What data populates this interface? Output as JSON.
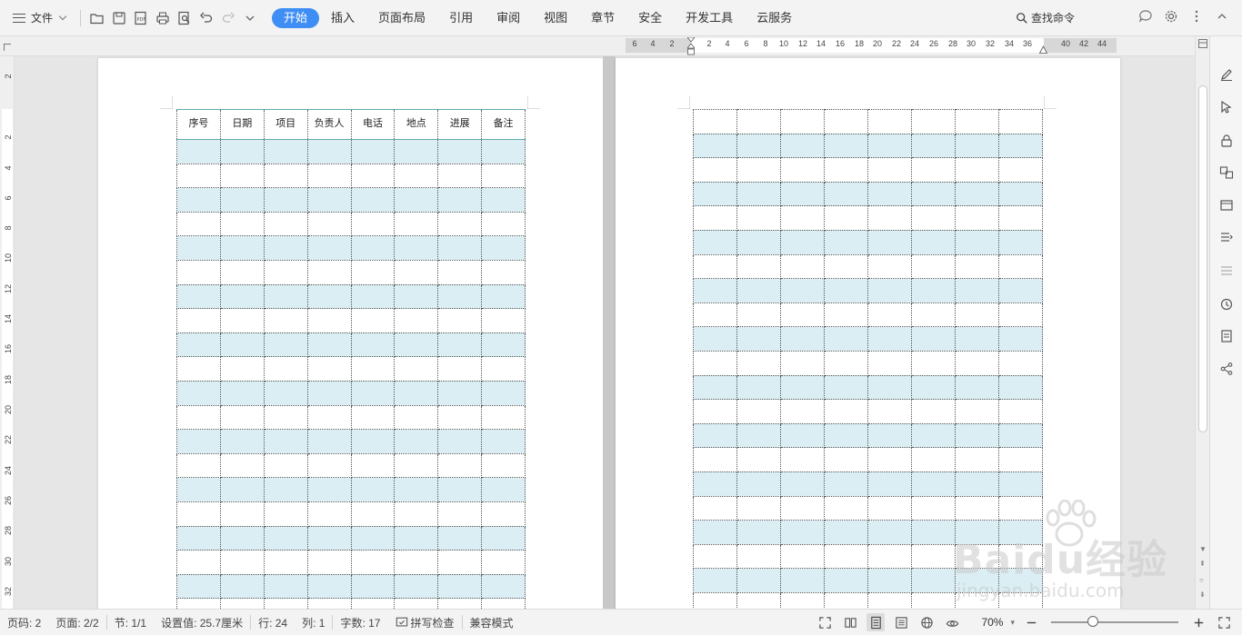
{
  "toolbar": {
    "file_label": "文件",
    "tabs": [
      {
        "label": "开始",
        "active": true
      },
      {
        "label": "插入",
        "active": false
      },
      {
        "label": "页面布局",
        "active": false
      },
      {
        "label": "引用",
        "active": false
      },
      {
        "label": "审阅",
        "active": false
      },
      {
        "label": "视图",
        "active": false
      },
      {
        "label": "章节",
        "active": false
      },
      {
        "label": "安全",
        "active": false
      },
      {
        "label": "开发工具",
        "active": false
      },
      {
        "label": "云服务",
        "active": false
      }
    ],
    "search_label": "查找命令",
    "quick_access_icons": [
      "open-folder-icon",
      "save-icon",
      "pdf-icon",
      "print-icon",
      "print-preview-icon",
      "undo-icon",
      "redo-icon",
      "dropdown-icon"
    ],
    "accent_color": "#3f8ef5"
  },
  "ruler": {
    "horizontal_ticks": [
      "6",
      "4",
      "2",
      "2",
      "4",
      "6",
      "8",
      "10",
      "12",
      "14",
      "16",
      "18",
      "20",
      "22",
      "24",
      "26",
      "28",
      "30",
      "32",
      "34",
      "36",
      "40",
      "42",
      "44"
    ],
    "vertical_ticks": [
      "2",
      "2",
      "4",
      "6",
      "8",
      "10",
      "12",
      "14",
      "16",
      "18",
      "20",
      "22",
      "24",
      "26",
      "28",
      "30",
      "32"
    ]
  },
  "table": {
    "headers": [
      "序号",
      "日期",
      "项目",
      "负责人",
      "电话",
      "地点",
      "进展",
      "备注"
    ],
    "shade_color": "#daeef3"
  },
  "side_panel_icons": [
    "pen-icon",
    "select-cursor-icon",
    "lock-icon",
    "translate-icon",
    "archive-icon",
    "outline-icon",
    "adjust-icon",
    "history-icon",
    "document-info-icon",
    "share-icon"
  ],
  "statusbar": {
    "page_num": "页码: 2",
    "page_total": "页面: 2/2",
    "section": "节: 1/1",
    "setting": "设置值: 25.7厘米",
    "row": "行: 24",
    "col": "列: 1",
    "word_count": "字数: 17",
    "spell_check": "拼写检查",
    "compat_mode": "兼容模式",
    "zoom": "70%"
  },
  "watermark": {
    "brand": "Baidu经验",
    "url": "jingyan.baidu.com"
  }
}
